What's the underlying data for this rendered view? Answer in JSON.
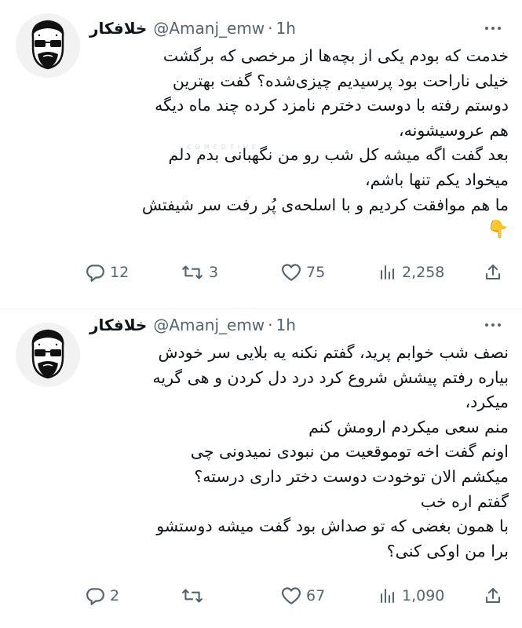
{
  "tweets": [
    {
      "author_name": "خلافکار",
      "handle": "@Amanj_emw",
      "separator": "·",
      "time": "1h",
      "lines": [
        "خدمت که بودم یکی از بچه‌ها از مرخصی که برگشت",
        "خیلی ناراحت بود پرسیدیم چیزی‌شده؟ گفت بهترین",
        "دوستم رفته با دوست دخترم نامزد کرده چند ماه دیگه",
        "هم عروسیشونه،",
        "بعد گفت اگه میشه کل شب رو من نگهبانی بدم دلم",
        "میخواد یکم تنها باشم،",
        "ما هم موافقت کردیم و با اسلحه‌ی پُر رفت سر شیفتش",
        "👇"
      ],
      "replies": "12",
      "reposts": "3",
      "likes": "75",
      "views": "2,258"
    },
    {
      "author_name": "خلافکار",
      "handle": "@Amanj_emw",
      "separator": "·",
      "time": "1h",
      "lines": [
        "نصف شب خوابم پرید، گفتم نکنه یه بلایی سر خودش",
        "بیاره رفتم پیشش شروع کرد درد دل کردن و هی گریه",
        "میکرد،",
        "منم سعی میکردم ارومش کنم",
        "اونم گفت اخه توموقعیت من نبودی نمیدونی چی",
        "میکشم الان توخودت دوست دختر داری درسته؟",
        "گفتم اره خب",
        "با همون بغضی که تو صداش بود گفت میشه دوستشو",
        "برا من اوکی کنی؟"
      ],
      "replies": "2",
      "reposts": "",
      "likes": "67",
      "views": "1,090"
    }
  ],
  "watermark": "COMEDTIVE",
  "icons": [
    "reply-icon",
    "repost-icon",
    "like-icon",
    "views-icon",
    "share-icon",
    "more-icon"
  ],
  "colors": {
    "text": "#0f1419",
    "secondary": "#536471",
    "divider": "#eff3f4"
  }
}
